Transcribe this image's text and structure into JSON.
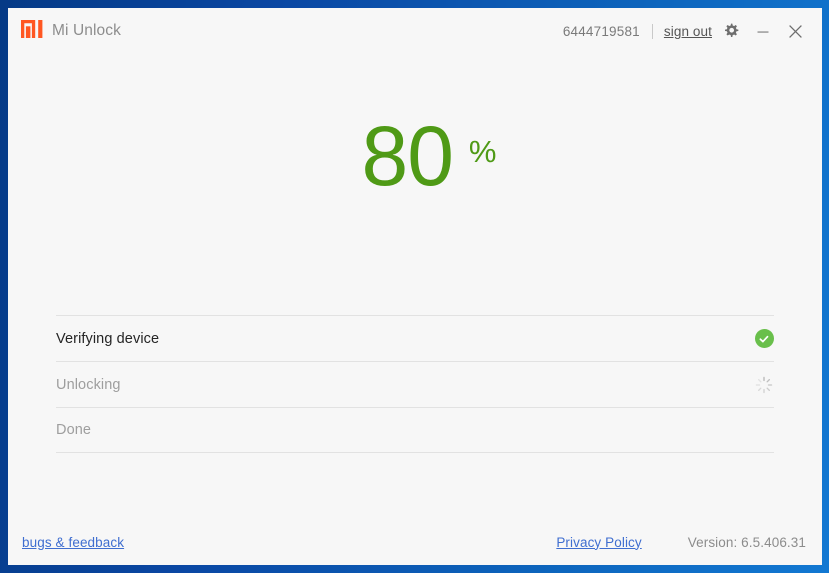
{
  "window": {
    "border_color": "#0a47a3",
    "background": "#f7f7f7"
  },
  "titlebar": {
    "logo_icon": "mi-logo-icon",
    "logo_color": "#ff5722",
    "app_title": "Mi Unlock",
    "account_id": "6444719581",
    "sign_out_label": "sign out",
    "settings_icon": "gear-icon",
    "minimize_icon": "minimize-icon",
    "close_icon": "close-icon"
  },
  "progress": {
    "value": "80",
    "unit": "%",
    "color": "#4f9a16"
  },
  "steps": [
    {
      "label": "Verifying device",
      "state": "done",
      "status_icon": "check-circle-icon"
    },
    {
      "label": "Unlocking",
      "state": "in-progress",
      "status_icon": "spinner-icon"
    },
    {
      "label": "Done",
      "state": "pending",
      "status_icon": ""
    }
  ],
  "footer": {
    "bugs_feedback_label": "bugs & feedback",
    "privacy_policy_label": "Privacy Policy",
    "version_text": "Version: 6.5.406.31",
    "link_color": "#3f6ed0"
  }
}
